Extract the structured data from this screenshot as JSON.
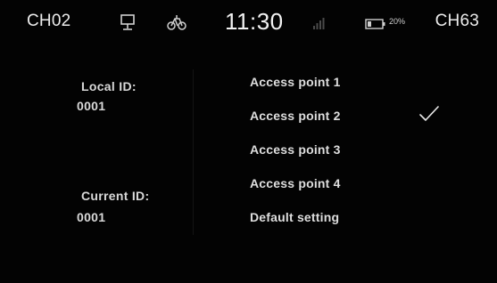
{
  "status_bar": {
    "channel_left": "CH02",
    "channel_right": "CH63",
    "time": "11:30",
    "battery_percent": "20%",
    "icons": [
      "monitor-icon",
      "bike-icon",
      "signal-icon",
      "battery-icon"
    ]
  },
  "left_panel": {
    "local_id_label": "Local ID:",
    "local_id_value": "0001",
    "current_id_label": "Current ID:",
    "current_id_value": "0001"
  },
  "menu": {
    "items": [
      {
        "label": "Access point 1",
        "selected": false
      },
      {
        "label": "Access point 2",
        "selected": true
      },
      {
        "label": "Access point 3",
        "selected": false
      },
      {
        "label": "Access point 4",
        "selected": false
      },
      {
        "label": "Default setting",
        "selected": false
      }
    ]
  },
  "colors": {
    "background": "#030303",
    "text": "#dedede"
  }
}
